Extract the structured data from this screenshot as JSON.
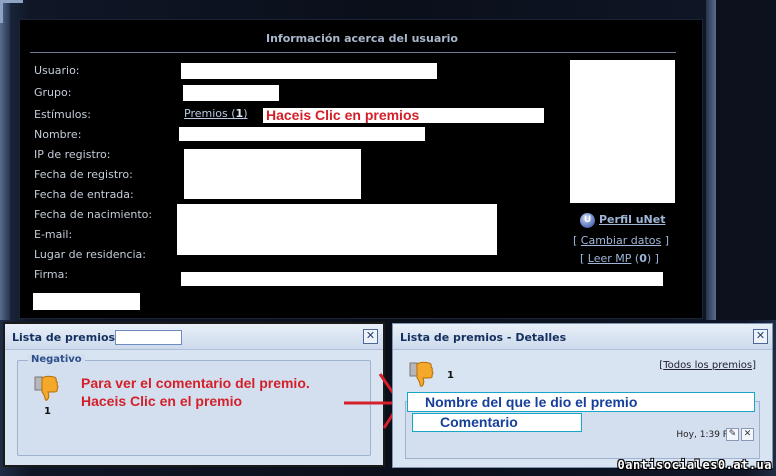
{
  "profile": {
    "title": "Información acerca del usuario",
    "labels": {
      "usuario": "Usuario:",
      "grupo": "Grupo:",
      "estimulos": "Estímulos:",
      "nombre": "Nombre:",
      "ip": "IP de registro:",
      "fecha_registro": "Fecha de registro:",
      "fecha_entrada": "Fecha de entrada:",
      "fecha_nacimiento": "Fecha de nacimiento:",
      "email": "E-mail:",
      "lugar": "Lugar de residencia:",
      "firma": "Firma:"
    },
    "premios_link": "Premios",
    "premios_count": "1",
    "premios_hint": "Haceis Clic en premios",
    "unet_link": "Perfil uNet",
    "cambiar_datos": "Cambiar datos",
    "leer_mp": "Leer MP",
    "leer_mp_count": "0"
  },
  "awards_list": {
    "title": "Lista de premios -",
    "group_label": "Negativo",
    "count": "1",
    "hint_line1": "Para ver el comentario del premio.",
    "hint_line2": "Haceis Clic en el premio"
  },
  "award_details": {
    "title": "Lista de premios - Detalles",
    "count": "1",
    "all_awards_link": "Todos los premios",
    "giver_hint": "Nombre del que le dio el premio",
    "comment_hint": "Comentario",
    "timestamp": "Hoy, 1:39 PM"
  },
  "colors": {
    "accent_red": "#d4202a",
    "hint_blue": "#163f9c",
    "panel_bg": "#000000",
    "window_bg": "#d9e4f2"
  },
  "watermark": "0antisociales0.at.ua"
}
